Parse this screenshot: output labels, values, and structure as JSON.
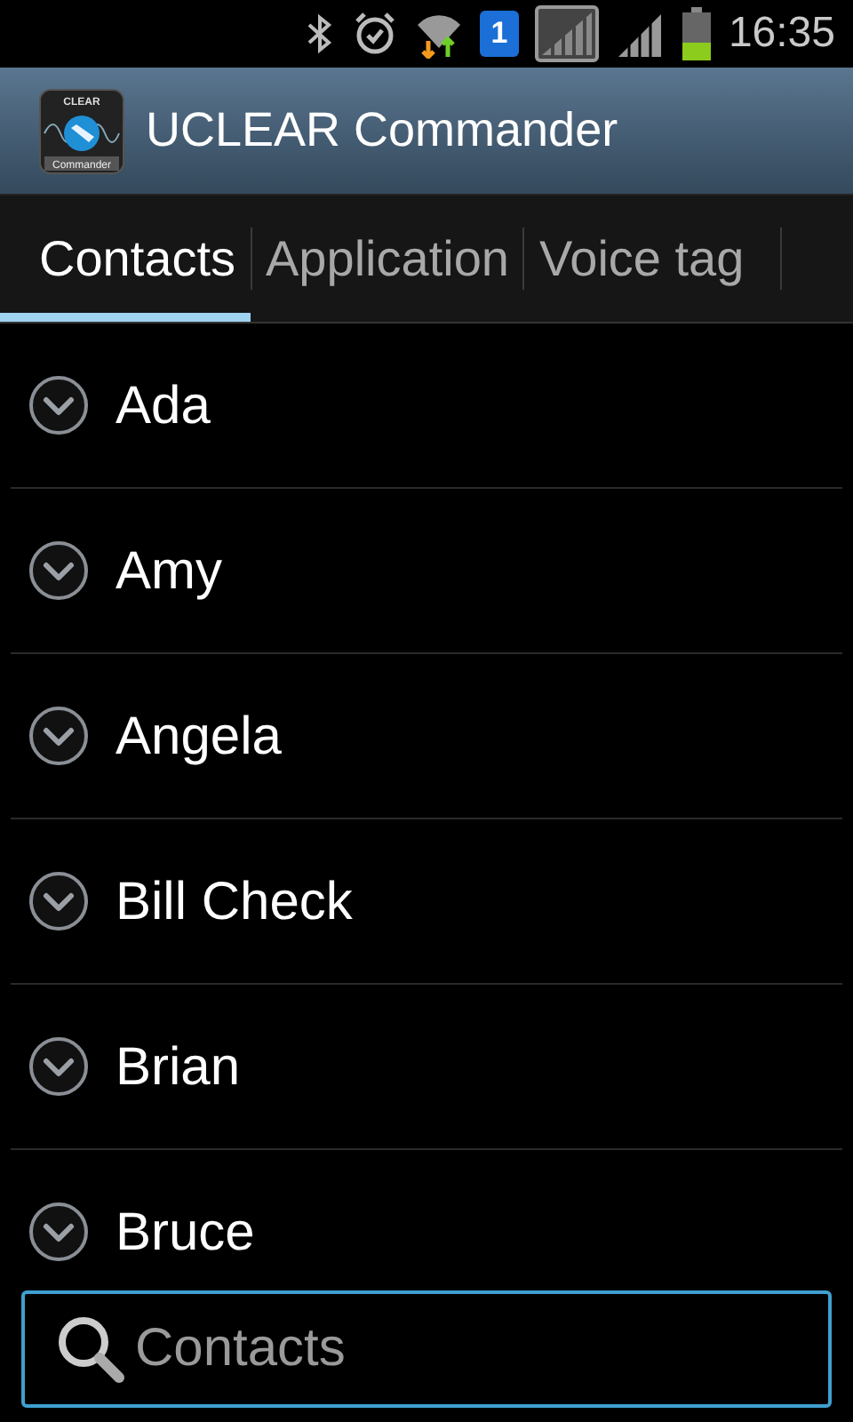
{
  "status_bar": {
    "sim_badge": "1",
    "time": "16:35"
  },
  "app_bar": {
    "icon_labels": [
      "CLEAR",
      "Commander"
    ],
    "title": "UCLEAR Commander"
  },
  "tabs": [
    {
      "label": "Contacts",
      "selected": true
    },
    {
      "label": "Application",
      "selected": false
    },
    {
      "label": "Voice tag",
      "selected": false
    }
  ],
  "contacts": [
    {
      "name": "Ada",
      "expanded": false
    },
    {
      "name": "Amy",
      "expanded": false
    },
    {
      "name": "Angela",
      "expanded": false
    },
    {
      "name": "Bill Check",
      "expanded": false
    },
    {
      "name": "Brian",
      "expanded": false
    },
    {
      "name": "Bruce",
      "expanded": false
    }
  ],
  "search": {
    "placeholder": "Contacts"
  }
}
